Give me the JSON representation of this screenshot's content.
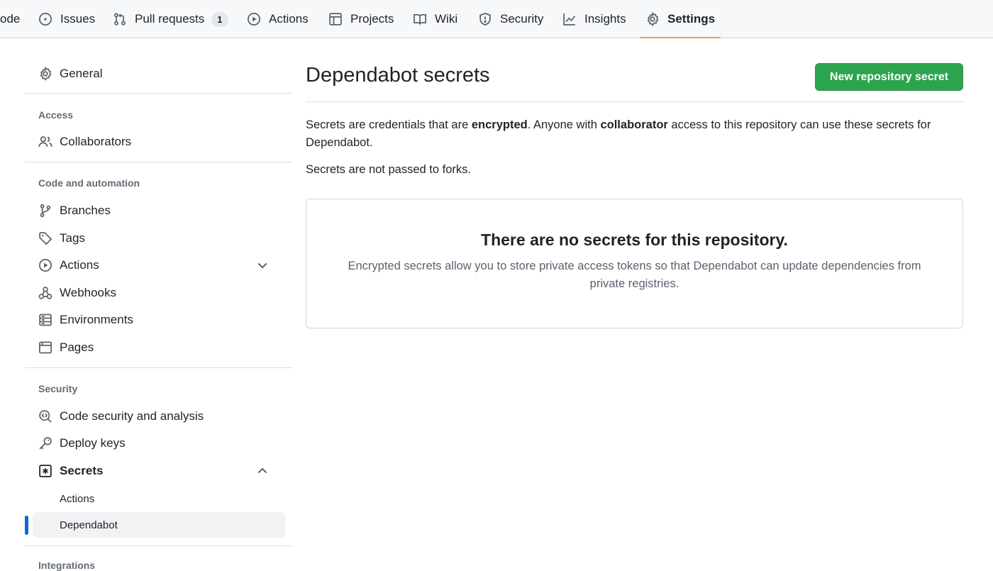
{
  "nav": {
    "items": [
      {
        "label": "ode",
        "icon": "code-icon"
      },
      {
        "label": "Issues",
        "icon": "issue-opened-icon"
      },
      {
        "label": "Pull requests",
        "icon": "git-pull-request-icon",
        "count": "1"
      },
      {
        "label": "Actions",
        "icon": "play-icon"
      },
      {
        "label": "Projects",
        "icon": "table-icon"
      },
      {
        "label": "Wiki",
        "icon": "book-icon"
      },
      {
        "label": "Security",
        "icon": "shield-icon"
      },
      {
        "label": "Insights",
        "icon": "graph-icon"
      },
      {
        "label": "Settings",
        "icon": "gear-icon",
        "selected": true
      }
    ],
    "selected_underline_color": "#fd8c73"
  },
  "sidebar": {
    "general": "General",
    "sections": {
      "access": {
        "heading": "Access",
        "items": [
          "Collaborators"
        ]
      },
      "code_automation": {
        "heading": "Code and automation",
        "items": [
          "Branches",
          "Tags",
          "Actions",
          "Webhooks",
          "Environments",
          "Pages"
        ]
      },
      "security": {
        "heading": "Security",
        "items": [
          "Code security and analysis",
          "Deploy keys",
          "Secrets"
        ],
        "secrets_subitems": [
          "Actions",
          "Dependabot"
        ],
        "active_subitem": "Dependabot"
      },
      "integrations": {
        "heading": "Integrations"
      }
    }
  },
  "main": {
    "title": "Dependabot secrets",
    "new_button": "New repository secret",
    "desc1": {
      "part1": "Secrets are credentials that are ",
      "bold1": "encrypted",
      "part2": ". Anyone with ",
      "bold2": "collaborator",
      "part3": " access to this repository can use these secrets for Dependabot."
    },
    "desc2": "Secrets are not passed to forks.",
    "blankslate": {
      "title": "There are no secrets for this repository.",
      "text": "Encrypted secrets allow you to store private access tokens so that Dependabot can update dependencies from private registries."
    }
  },
  "colors": {
    "primary_button": "#2da44e",
    "active_indicator": "#0969da",
    "active_item_bg": "#f1f2f4"
  }
}
